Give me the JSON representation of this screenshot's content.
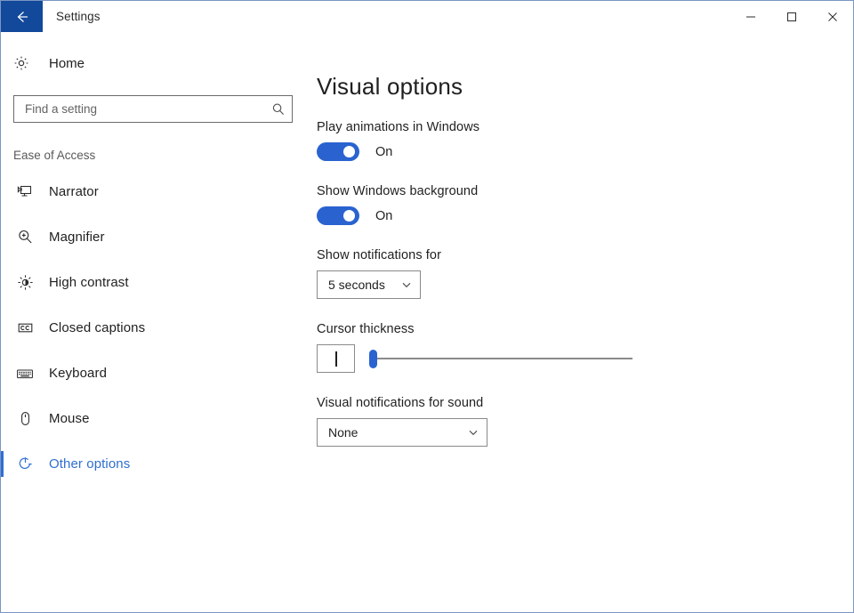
{
  "window": {
    "title": "Settings",
    "back_icon": "arrow-left-icon",
    "accent_blue": "#2a63d0",
    "titlebar_blue": "#12499b",
    "caption_buttons": [
      {
        "name": "minimize",
        "icon": "minimize-icon"
      },
      {
        "name": "maximize",
        "icon": "maximize-icon"
      },
      {
        "name": "close",
        "icon": "close-icon"
      }
    ]
  },
  "sidebar": {
    "home_label": "Home",
    "home_icon": "gear-icon",
    "search": {
      "placeholder": "Find a setting",
      "value": "",
      "icon": "search-icon"
    },
    "group_header": "Ease of Access",
    "items": [
      {
        "label": "Narrator",
        "icon": "narrator-icon",
        "selected": false
      },
      {
        "label": "Magnifier",
        "icon": "magnifier-icon",
        "selected": false
      },
      {
        "label": "High contrast",
        "icon": "brightness-icon",
        "selected": false
      },
      {
        "label": "Closed captions",
        "icon": "closed-captions-icon",
        "selected": false
      },
      {
        "label": "Keyboard",
        "icon": "keyboard-icon",
        "selected": false
      },
      {
        "label": "Mouse",
        "icon": "mouse-icon",
        "selected": false
      },
      {
        "label": "Other options",
        "icon": "other-options-icon",
        "selected": true
      }
    ]
  },
  "main": {
    "page_title": "Visual options",
    "play_animations": {
      "label": "Play animations in Windows",
      "state": "On",
      "checked": true
    },
    "show_background": {
      "label": "Show Windows background",
      "state": "On",
      "checked": true
    },
    "show_notifications": {
      "label": "Show notifications for",
      "value": "5 seconds",
      "chevron": "chevron-down-icon"
    },
    "cursor_thickness": {
      "label": "Cursor thickness",
      "preview": "cursor-caret-preview",
      "slider_value": 0,
      "slider_min": 0,
      "slider_max": 100
    },
    "visual_notifications": {
      "label": "Visual notifications for sound",
      "value": "None",
      "chevron": "chevron-down-icon"
    }
  }
}
